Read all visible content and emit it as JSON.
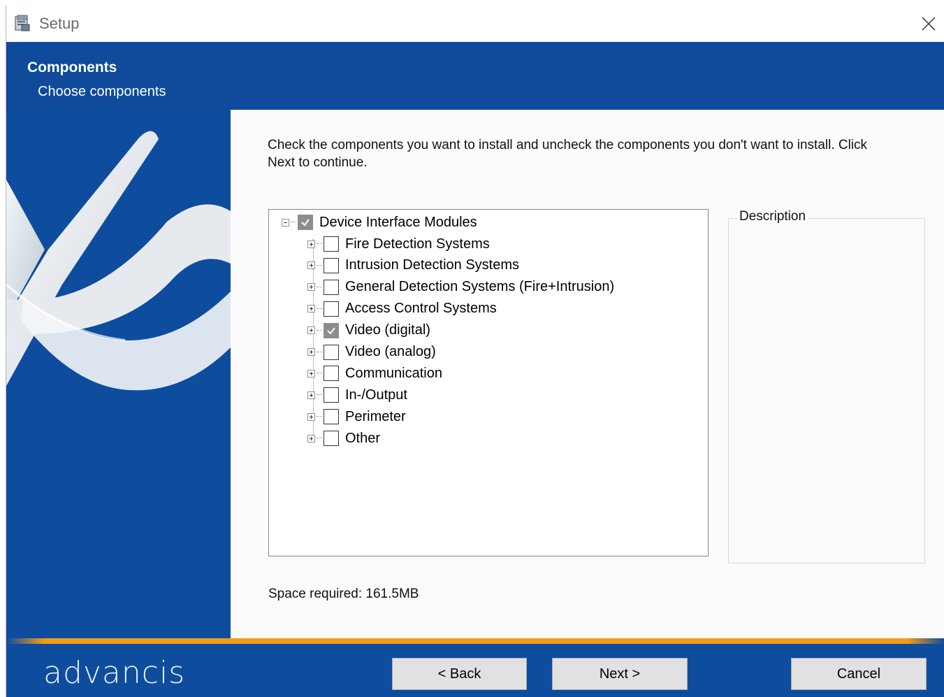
{
  "window": {
    "title": "Setup"
  },
  "header": {
    "title": "Components",
    "subtitle": "Choose components"
  },
  "main": {
    "instructions": "Check the components you want to install and uncheck the components you don't want to install. Click Next to continue.",
    "tree": {
      "root": {
        "label": "Device Interface Modules",
        "checked": true,
        "expanded": true
      },
      "items": [
        {
          "label": "Fire Detection Systems",
          "checked": false
        },
        {
          "label": "Intrusion Detection Systems",
          "checked": false
        },
        {
          "label": "General Detection Systems (Fire+Intrusion)",
          "checked": false
        },
        {
          "label": "Access Control Systems",
          "checked": false
        },
        {
          "label": "Video (digital)",
          "checked": true
        },
        {
          "label": "Video (analog)",
          "checked": false
        },
        {
          "label": "Communication",
          "checked": false
        },
        {
          "label": "In-/Output",
          "checked": false
        },
        {
          "label": "Perimeter",
          "checked": false
        },
        {
          "label": "Other",
          "checked": false
        }
      ]
    },
    "description_label": "Description",
    "space_required": "Space required: 161.5MB"
  },
  "footer": {
    "brand": "advancis",
    "back_label": "< Back",
    "next_label": "Next >",
    "cancel_label": "Cancel"
  },
  "colors": {
    "brand_blue": "#0f4a9b",
    "accent_orange": "#f39a1a"
  }
}
